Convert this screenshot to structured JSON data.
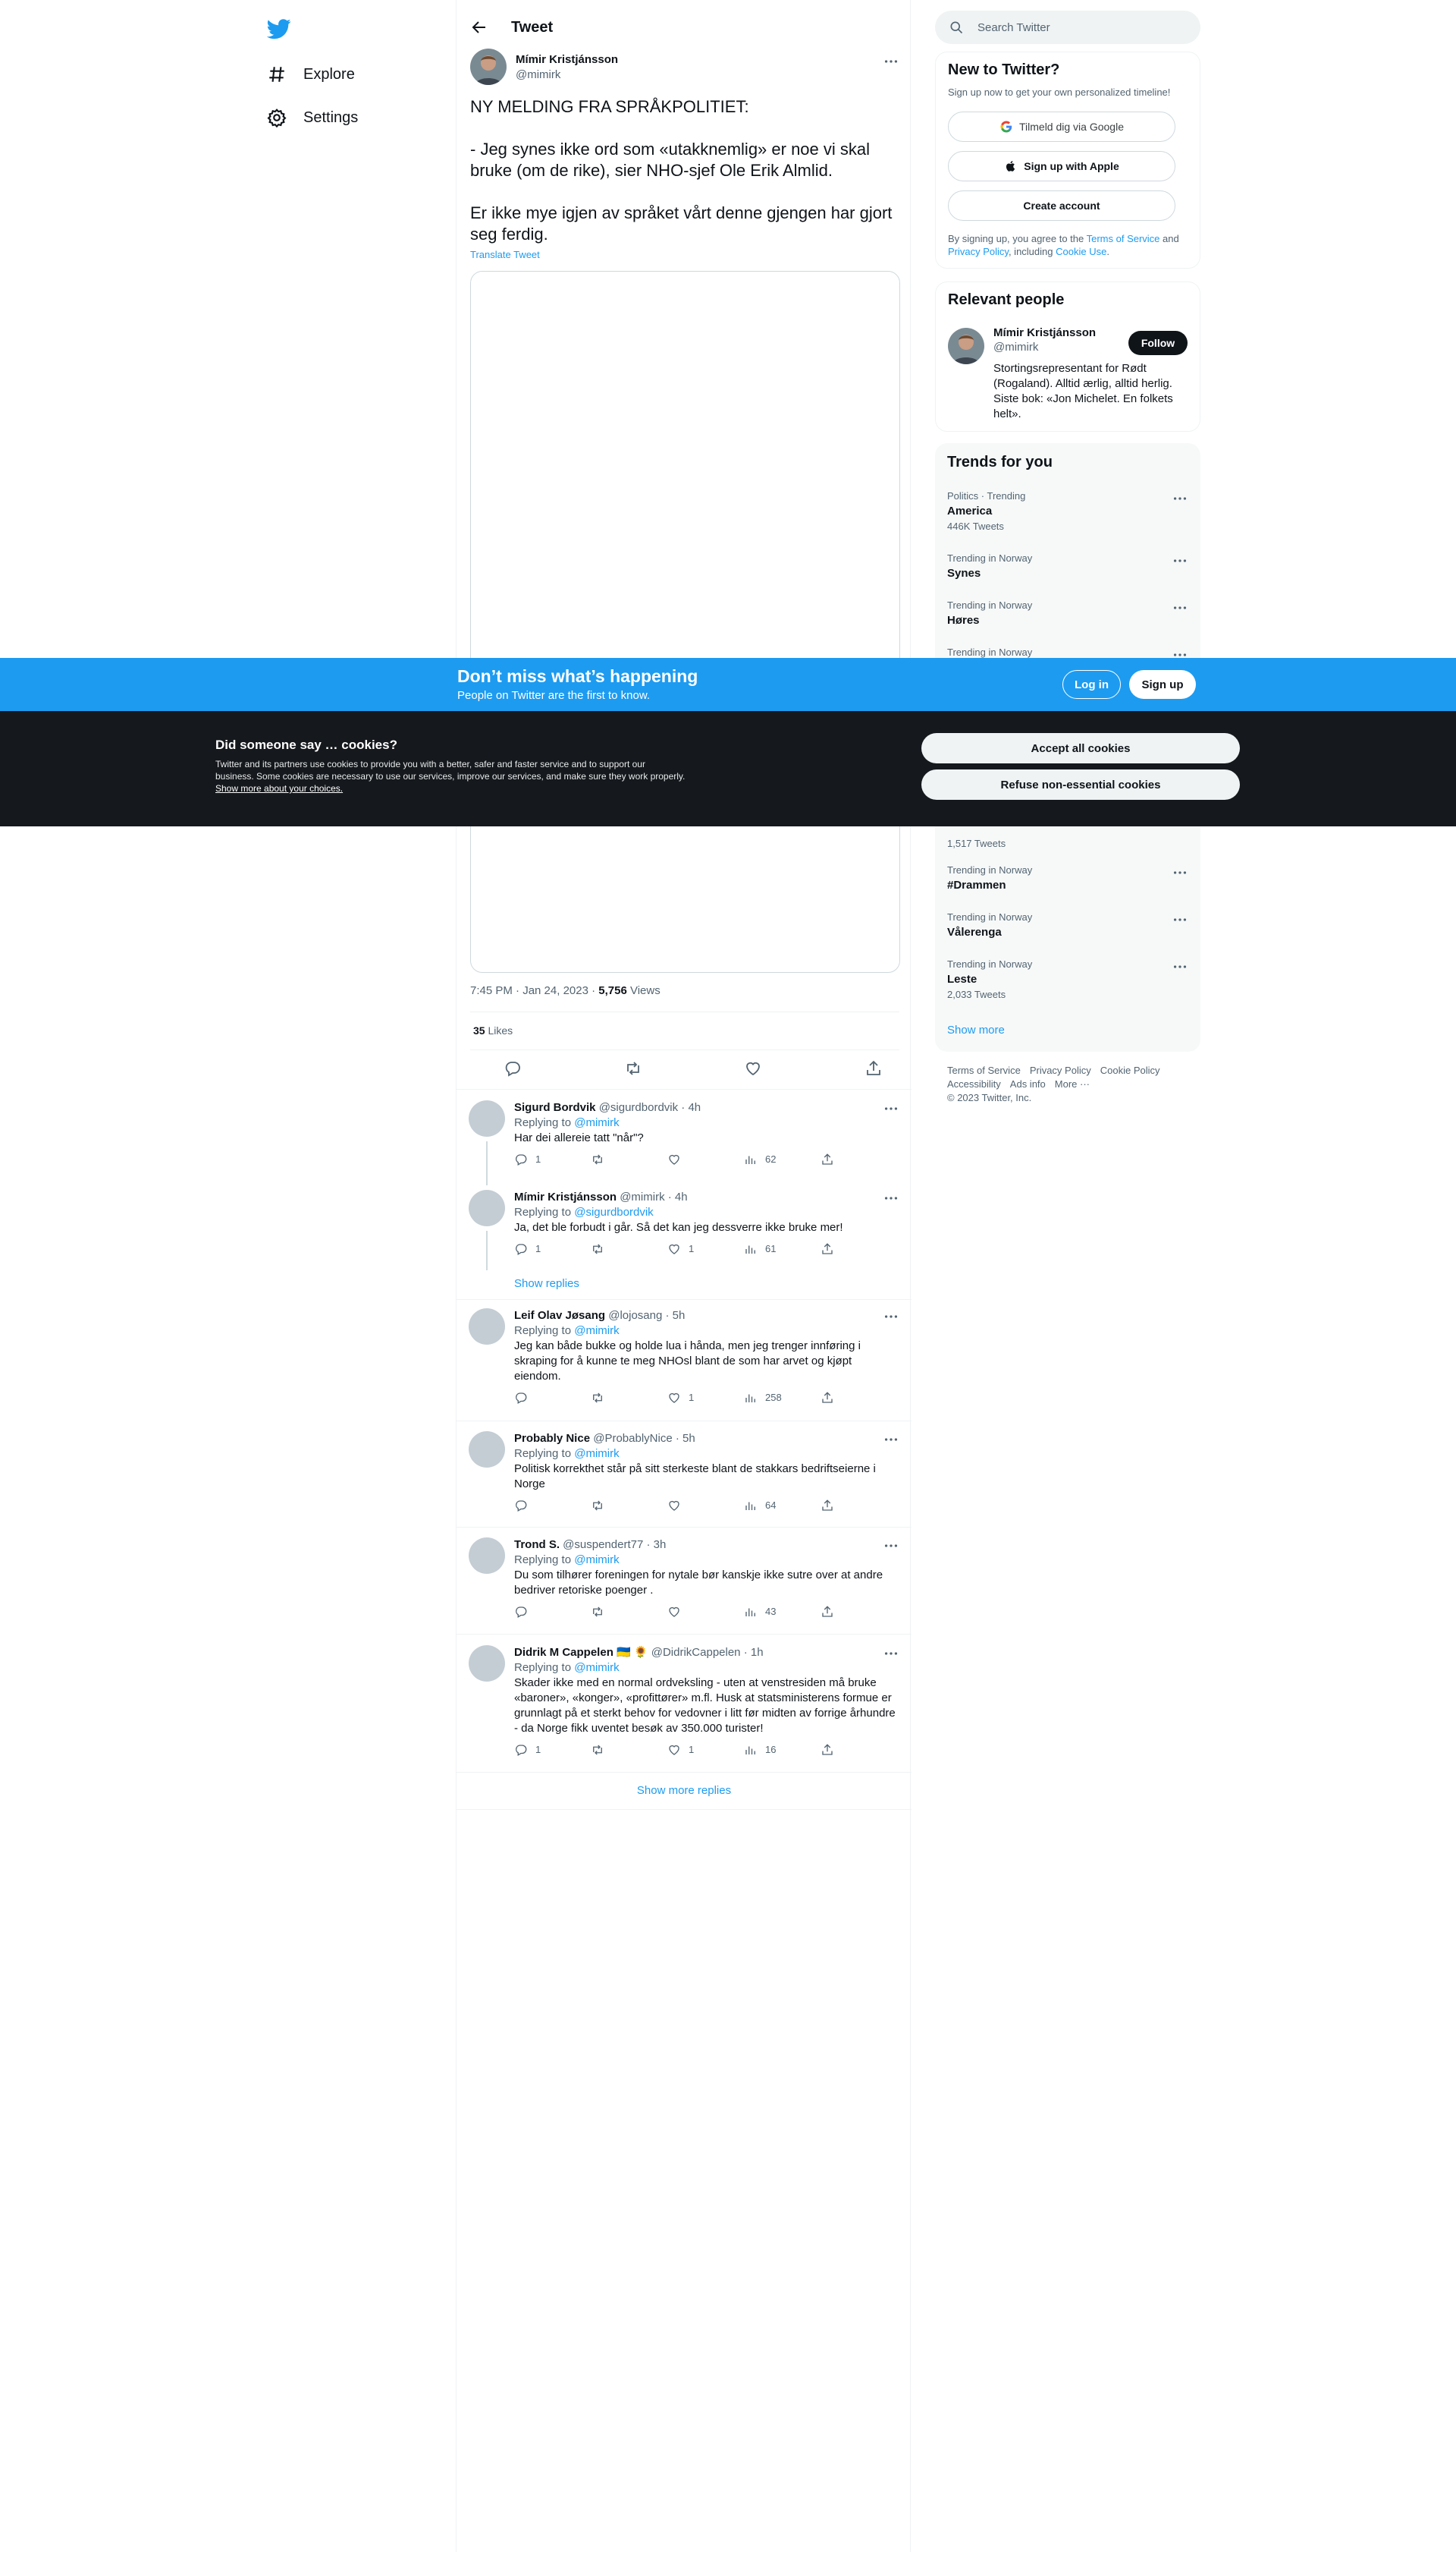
{
  "nav": {
    "explore": "Explore",
    "settings": "Settings"
  },
  "header": {
    "title": "Tweet"
  },
  "tweet": {
    "author_name": "Mímir Kristjánsson",
    "author_handle": "@mimirk",
    "text": "NY MELDING FRA SPRÅKPOLITIET:\n\n- Jeg synes ikke ord som «utakknemlig» er noe vi skal bruke (om de rike), sier NHO-sjef Ole Erik Almlid.\n\nEr ikke mye igjen av språket vårt denne gjengen har gjort seg ferdig.",
    "translate": "Translate Tweet",
    "time": "7:45 PM · Jan 24, 2023 · ",
    "views_count": "5,756",
    "views_label": " Views",
    "likes_count": "35",
    "likes_label": " Likes"
  },
  "replies": [
    {
      "name": "Sigurd Bordvik",
      "handle": "@sigurdbordvik",
      "time": "· 4h",
      "replying": "Replying to ",
      "to": "@mimirk",
      "text": "Har dei allereie tatt \"når\"?",
      "reply_count": "1",
      "retweets": "",
      "likes": "",
      "views": "62"
    },
    {
      "name": "Mímir Kristjánsson",
      "handle": "@mimirk",
      "time": "· 4h",
      "replying": "Replying to ",
      "to": "@sigurdbordvik",
      "text": "Ja, det ble forbudt i går. Så det kan jeg dessverre ikke bruke mer!",
      "reply_count": "1",
      "retweets": "",
      "likes": "1",
      "views": "61"
    },
    {
      "name": "Leif Olav Jøsang",
      "handle": "@lojosang",
      "time": "· 5h",
      "replying": "Replying to ",
      "to": "@mimirk",
      "text": "Jeg kan både bukke og holde lua i hånda, men jeg trenger innføring i skraping for å kunne te meg NHOsl blant de som har arvet og kjøpt eiendom.",
      "reply_count": "",
      "retweets": "",
      "likes": "1",
      "views": "258"
    },
    {
      "name": "Probably Nice",
      "handle": "@ProbablyNice",
      "time": "· 5h",
      "replying": "Replying to ",
      "to": "@mimirk",
      "text": "Politisk korrekthet står på sitt sterkeste blant de stakkars bedriftseierne i Norge",
      "reply_count": "",
      "retweets": "",
      "likes": "",
      "views": "64"
    },
    {
      "name": "Trond S.",
      "handle": "@suspendert77",
      "time": "· 3h",
      "replying": "Replying to ",
      "to": "@mimirk",
      "text": "Du som tilhører foreningen for nytale bør kanskje ikke sutre over at andre bedriver retoriske poenger .",
      "reply_count": "",
      "retweets": "",
      "likes": "",
      "views": "43"
    },
    {
      "name": "Didrik M Cappelen",
      "flags": "🇺🇦 🌻",
      "handle": "@DidrikCappelen",
      "time": "· 1h",
      "replying": "Replying to ",
      "to": "@mimirk",
      "text": "Skader ikke med en normal ordveksling - uten at venstresiden må bruke «baroner», «konger», «profittører» m.fl. Husk at statsministerens formue er grunnlagt på et sterkt behov for vedovner i litt før midten av forrige århundre - da Norge fikk uventet besøk av 350.000 turister!",
      "reply_count": "1",
      "retweets": "",
      "likes": "1",
      "views": "16"
    }
  ],
  "show_replies": "Show replies",
  "show_more_replies": "Show more replies",
  "search": {
    "placeholder": "Search Twitter"
  },
  "new_to_twitter": {
    "title": "New to Twitter?",
    "subtitle": "Sign up now to get your own personalized timeline!",
    "google": "Tilmeld dig via Google",
    "apple": "Sign up with Apple",
    "create": "Create account",
    "terms_a": "By signing up, you agree to the ",
    "terms_link": "Terms of Service",
    "terms_b": " and ",
    "privacy_link": "Privacy Policy",
    "terms_c": ", including ",
    "cookie_link": "Cookie Use",
    "terms_d": "."
  },
  "relevant": {
    "title": "Relevant people",
    "name": "Mímir Kristjánsson",
    "handle": "@mimirk",
    "follow": "Follow",
    "bio": "Stortingsrepresentant for Rødt (Rogaland). Alltid ærlig, alltid herlig. Siste bok: «Jon Michelet. En folkets helt»."
  },
  "trends": {
    "title": "Trends for you",
    "items": [
      {
        "context": "Politics · Trending",
        "name": "America",
        "count": "446K Tweets"
      },
      {
        "context": "Trending in Norway",
        "name": "Synes",
        "count": ""
      },
      {
        "context": "Trending in Norway",
        "name": "Høres",
        "count": ""
      },
      {
        "context": "Trending in Norway",
        "name": "",
        "count": ""
      },
      {
        "context": "",
        "name": "",
        "count": "1,517 Tweets"
      },
      {
        "context": "Trending in Norway",
        "name": "#Drammen",
        "count": ""
      },
      {
        "context": "Trending in Norway",
        "name": "Vålerenga",
        "count": ""
      },
      {
        "context": "Trending in Norway",
        "name": "Leste",
        "count": "2,033 Tweets"
      }
    ],
    "show_more": "Show more"
  },
  "footer": {
    "terms": "Terms of Service",
    "privacy": "Privacy Policy",
    "cookie": "Cookie Policy",
    "accessibility": "Accessibility",
    "ads": "Ads info",
    "more": "More ···",
    "copyright": "© 2023 Twitter, Inc."
  },
  "promo": {
    "title": "Don’t miss what’s happening",
    "subtitle": "People on Twitter are the first to know.",
    "login": "Log in",
    "signup": "Sign up"
  },
  "cookies": {
    "title": "Did someone say … cookies?",
    "body": "Twitter and its partners use cookies to provide you with a better, safer and faster service and to support our business. Some cookies are necessary to use our services, improve our services, and make sure they work properly. ",
    "link": "Show more about your choices.",
    "accept": "Accept all cookies",
    "refuse": "Refuse non-essential cookies"
  },
  "colors": {
    "accent": "#1d9bf0",
    "text": "#0f1419",
    "muted": "#536471",
    "cookie_bg": "#15181c"
  }
}
